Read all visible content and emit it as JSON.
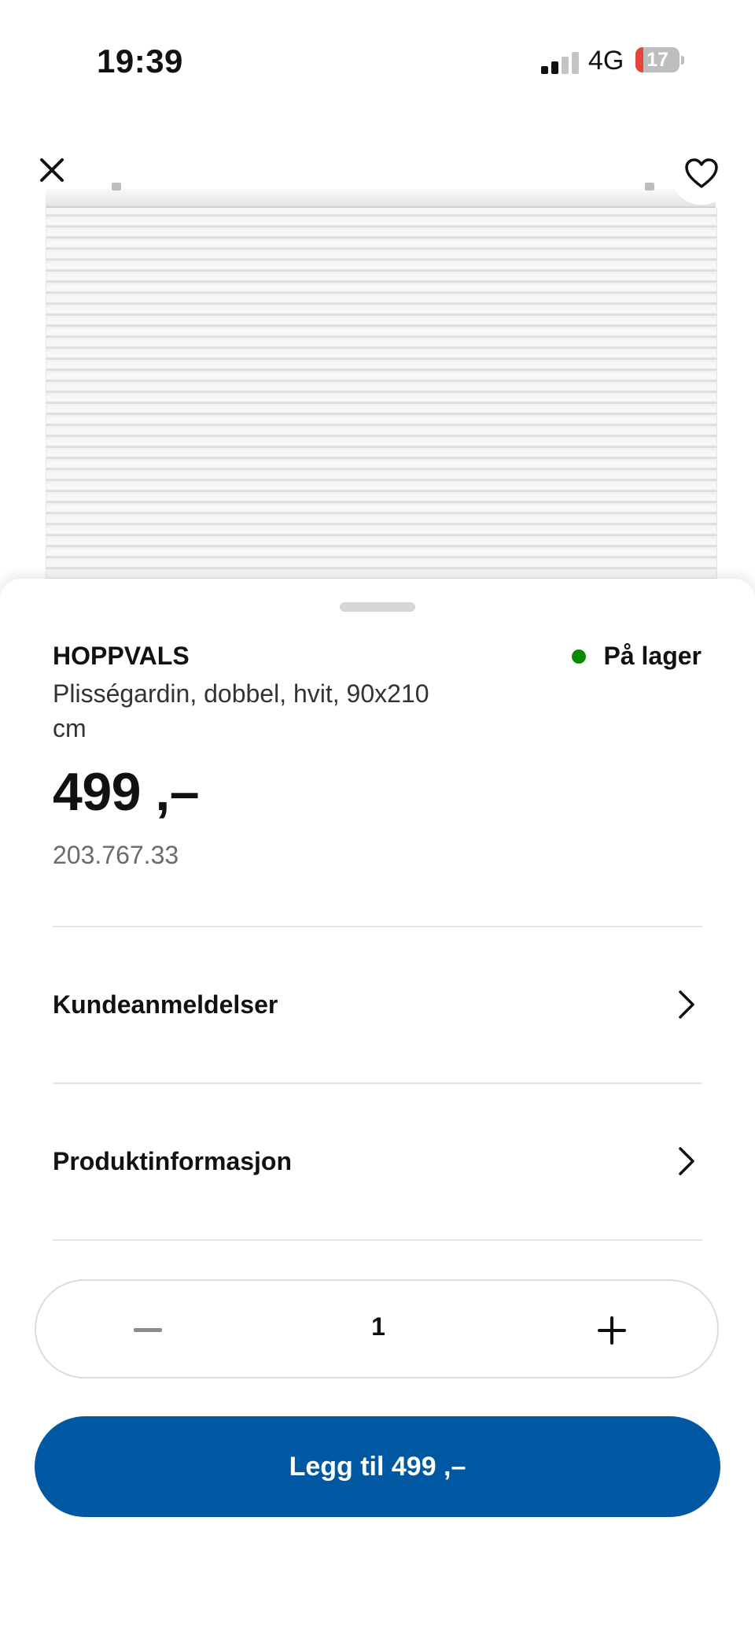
{
  "status_bar": {
    "time": "19:39",
    "network": "4G",
    "battery_percent": "17",
    "battery_level": 0.17,
    "signal_bars_active": 2,
    "signal_bars_total": 4
  },
  "image": {
    "close_icon": "close-icon",
    "favorite_icon": "heart-icon"
  },
  "product": {
    "name": "HOPPVALS",
    "description": "Plisségardin, dobbel, hvit, 90x210 cm",
    "stock_status": "På lager",
    "stock_color": "#0a8a00",
    "price": "499 ,–",
    "article_number": "203.767.33"
  },
  "sections": [
    {
      "label": "Kundeanmeldelser",
      "icon": "chevron-right-icon"
    },
    {
      "label": "Produktinformasjon",
      "icon": "chevron-right-icon"
    }
  ],
  "quantity": {
    "value": "1",
    "minus_icon": "minus-icon",
    "plus_icon": "plus-icon"
  },
  "cta": {
    "label": "Legg til 499 ,–",
    "color": "#0058a3"
  }
}
